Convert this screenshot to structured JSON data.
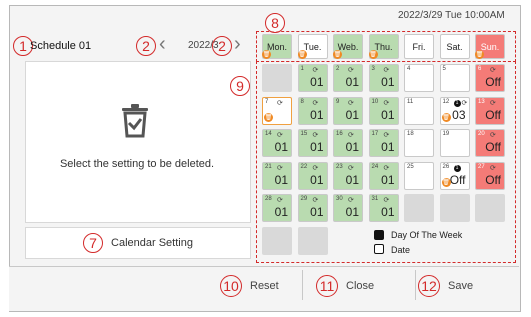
{
  "header": {
    "datetime": "2022/3/29 Tue 10:00AM",
    "schedule_title": "Schedule 01",
    "month": "2022/3"
  },
  "markers": {
    "m1": "1",
    "m2": "2",
    "m3": "2",
    "m7": "7",
    "m8": "8",
    "m9": "9",
    "m10": "10",
    "m11": "11",
    "m12": "12"
  },
  "left_panel": {
    "delete_message": "Select the setting to be deleted.",
    "calendar_setting_label": "Calendar Setting"
  },
  "week_row": [
    {
      "label": "Mon.",
      "color": "green",
      "trash": true
    },
    {
      "label": "Tue.",
      "color": "white",
      "trash": true
    },
    {
      "label": "Web.",
      "color": "green",
      "trash": true
    },
    {
      "label": "Thu.",
      "color": "green",
      "trash": true
    },
    {
      "label": "Fri.",
      "color": "white",
      "trash": false
    },
    {
      "label": "Sat.",
      "color": "white",
      "trash": false
    },
    {
      "label": "Sun.",
      "color": "red",
      "trash": true
    }
  ],
  "calendar": [
    [
      {
        "type": "empty"
      },
      {
        "day": "1",
        "pattern": "01",
        "color": "green",
        "sync": true
      },
      {
        "day": "2",
        "pattern": "01",
        "color": "green",
        "sync": true
      },
      {
        "day": "3",
        "pattern": "01",
        "color": "green",
        "sync": true
      },
      {
        "day": "4",
        "pattern": "",
        "color": "white"
      },
      {
        "day": "5",
        "pattern": "",
        "color": "white"
      },
      {
        "day": "6",
        "pattern": "Off",
        "color": "red",
        "sync": true
      }
    ],
    [
      {
        "day": "7",
        "pattern": "",
        "color": "white",
        "sync": true,
        "selected": true,
        "trash": true
      },
      {
        "day": "8",
        "pattern": "01",
        "color": "green",
        "sync": true
      },
      {
        "day": "9",
        "pattern": "01",
        "color": "green",
        "sync": true
      },
      {
        "day": "10",
        "pattern": "01",
        "color": "green",
        "sync": true
      },
      {
        "day": "11",
        "pattern": "",
        "color": "white"
      },
      {
        "day": "12",
        "pattern": "03",
        "color": "white",
        "dot": true,
        "dot_label": "1",
        "sync": true,
        "trash": true
      },
      {
        "day": "13",
        "pattern": "Off",
        "color": "red",
        "sync": true
      }
    ],
    [
      {
        "day": "14",
        "pattern": "01",
        "color": "green",
        "sync": true
      },
      {
        "day": "15",
        "pattern": "01",
        "color": "green",
        "sync": true
      },
      {
        "day": "16",
        "pattern": "01",
        "color": "green",
        "sync": true
      },
      {
        "day": "17",
        "pattern": "01",
        "color": "green",
        "sync": true
      },
      {
        "day": "18",
        "pattern": "",
        "color": "white"
      },
      {
        "day": "19",
        "pattern": "",
        "color": "white"
      },
      {
        "day": "20",
        "pattern": "Off",
        "color": "red",
        "sync": true
      }
    ],
    [
      {
        "day": "21",
        "pattern": "01",
        "color": "green",
        "sync": true
      },
      {
        "day": "22",
        "pattern": "01",
        "color": "green",
        "sync": true
      },
      {
        "day": "23",
        "pattern": "01",
        "color": "green",
        "sync": true
      },
      {
        "day": "24",
        "pattern": "01",
        "color": "green",
        "sync": true
      },
      {
        "day": "25",
        "pattern": "",
        "color": "white"
      },
      {
        "day": "26",
        "pattern": "Off",
        "color": "white",
        "dot": true,
        "dot_label": "1",
        "trash": true
      },
      {
        "day": "27",
        "pattern": "Off",
        "color": "red",
        "sync": true
      }
    ],
    [
      {
        "day": "28",
        "pattern": "01",
        "color": "green",
        "sync": true
      },
      {
        "day": "29",
        "pattern": "01",
        "color": "green",
        "sync": true
      },
      {
        "day": "30",
        "pattern": "01",
        "color": "green",
        "sync": true
      },
      {
        "day": "31",
        "pattern": "01",
        "color": "green",
        "sync": true
      },
      {
        "type": "empty"
      },
      {
        "type": "empty"
      },
      {
        "type": "empty"
      }
    ],
    [
      {
        "type": "empty"
      },
      {
        "type": "empty"
      },
      {
        "type": "legend"
      },
      {
        "type": "legend"
      },
      {
        "type": "legend"
      },
      {
        "type": "legend"
      },
      {
        "type": "legend"
      }
    ]
  ],
  "legend": {
    "day_of_week": "Day Of The Week",
    "date": "Date"
  },
  "footer": {
    "reset": "Reset",
    "close": "Close",
    "save": "Save"
  },
  "colors": {
    "green": "#b9dbb0",
    "red": "#f47b77",
    "marker": "#d32a2a",
    "trash": "#f08a24"
  },
  "icons": {
    "trash": "trash-icon",
    "sync": "sync-icon",
    "chevron_left": "chevron-left-icon",
    "chevron_right": "chevron-right-icon",
    "delete_panel": "trash-check-icon"
  }
}
